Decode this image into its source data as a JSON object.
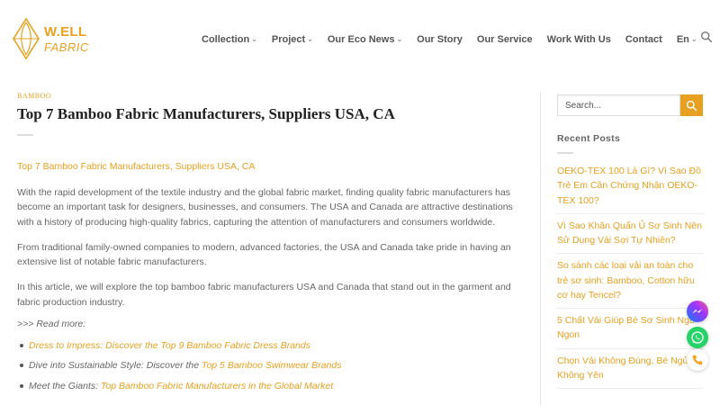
{
  "brand": {
    "name_top": "W.ELL",
    "name_bottom": "FABRIC",
    "color": "#e8a020"
  },
  "nav": {
    "items": [
      {
        "label": "Collection",
        "has_dropdown": true
      },
      {
        "label": "Project",
        "has_dropdown": true
      },
      {
        "label": "Our Eco News",
        "has_dropdown": true
      },
      {
        "label": "Our Story",
        "has_dropdown": false
      },
      {
        "label": "Our Service",
        "has_dropdown": false
      },
      {
        "label": "Work With Us",
        "has_dropdown": false
      },
      {
        "label": "Contact",
        "has_dropdown": false
      },
      {
        "label": "En",
        "has_dropdown": true
      }
    ],
    "search_icon": "search-icon"
  },
  "article": {
    "category": "BAMBOO",
    "title": "Top 7 Bamboo Fabric Manufacturers, Suppliers USA, CA",
    "link_text": "Top 7 Bamboo Fabric Manufacturers, Suppliers USA, CA",
    "paragraphs": [
      "With the rapid development of the textile industry and the global fabric market, finding quality fabric manufacturers has become an important task for designers, businesses, and consumers. The USA and Canada are attractive destinations with a history of producing high-quality fabrics, capturing the attention of manufacturers and consumers worldwide.",
      "From traditional family-owned companies to modern, advanced factories, the USA and Canada take pride in having an extensive list of notable fabric manufacturers.",
      "In this article, we will explore the top bamboo fabric manufacturers USA and Canada that stand out in the garment and fabric production industry."
    ],
    "read_more": ">>> Read more:",
    "bullets": [
      {
        "prefix": "",
        "link": "Dress to Impress: Discover the Top 9 Bamboo Fabric Dress Brands",
        "suffix": ""
      },
      {
        "prefix": "Dive into Sustainable Style: Discover the ",
        "link": "Top 5 Bamboo Swimwear Brands",
        "suffix": ""
      },
      {
        "prefix": "Meet the Giants: ",
        "link": "Top Bamboo Fabric Manufacturers in the Global Market",
        "suffix": ""
      }
    ]
  },
  "sidebar": {
    "search_placeholder": "Search...",
    "recent_title": "Recent Posts",
    "recent_posts": [
      "OEKO-TEX 100 Là Gì? Vì Sao Đồ Trẻ Em Cần Chứng Nhận OEKO-TEX 100?",
      "Vì Sao Khăn Quấn Ủ Sơ Sinh Nên Sử Dụng Vải Sợi Tự Nhiên?",
      "So sánh các loại vải an toàn cho trẻ sơ sinh: Bamboo, Cotton hữu cơ hay Tencel?",
      "5 Chất Vải Giúp Bé Sơ Sinh Ngủ Ngon",
      "Chọn Vải Không Đúng, Bé Ngủ Không Yên"
    ]
  },
  "floating_buttons": [
    {
      "icon": "messenger-icon",
      "color": "#7b4dff"
    },
    {
      "icon": "whatsapp-icon",
      "color": "#25d366"
    },
    {
      "icon": "phone-icon",
      "color": "#f7a21c"
    }
  ]
}
